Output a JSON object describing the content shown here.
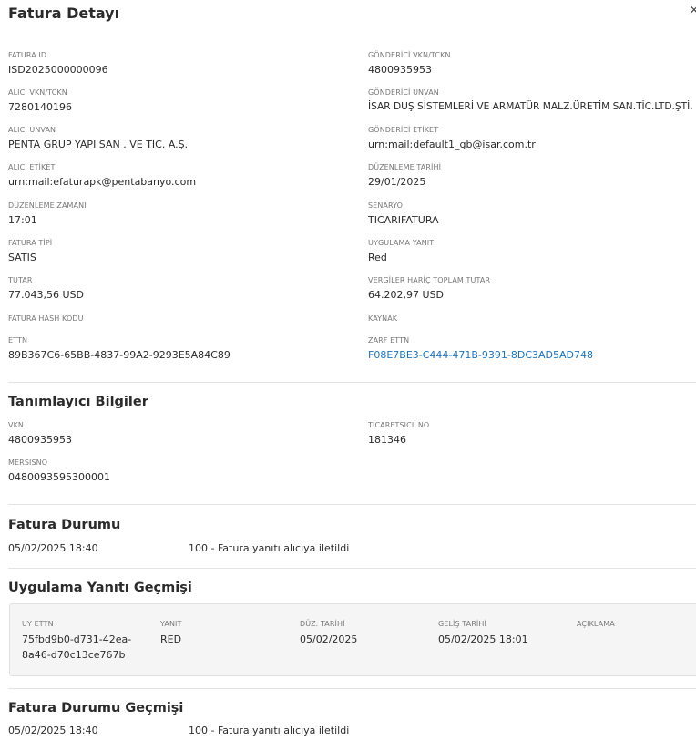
{
  "header": {
    "title": "Fatura Detayı",
    "close_label": "×"
  },
  "details": {
    "left": [
      {
        "label": "FATURA ID",
        "value": "ISD2025000000096"
      },
      {
        "label": "ALICI VKN/TCKN",
        "value": "7280140196"
      },
      {
        "label": "ALICI UNVAN",
        "value": "PENTA GRUP YAPI SAN . VE TİC. A.Ş."
      },
      {
        "label": "ALICI ETİKET",
        "value": "urn:mail:efaturapk@pentabanyo.com"
      },
      {
        "label": "DÜZENLEME ZAMANI",
        "value": "17:01"
      },
      {
        "label": "FATURA TİPİ",
        "value": "SATIS"
      },
      {
        "label": "TUTAR",
        "value": "77.043,56 USD"
      },
      {
        "label": "FATURA HASH KODU",
        "value": ""
      },
      {
        "label": "ETTN",
        "value": "89B367C6-65BB-4837-99A2-9293E5A84C89"
      }
    ],
    "right": [
      {
        "label": "GÖNDERİCİ VKN/TCKN",
        "value": "4800935953"
      },
      {
        "label": "GÖNDERİCİ UNVAN",
        "value": "İSAR DUŞ SİSTEMLERİ VE ARMATÜR MALZ.ÜRETİM SAN.TİC.LTD.ŞTİ."
      },
      {
        "label": "GÖNDERİCİ ETİKET",
        "value": "urn:mail:default1_gb@isar.com.tr"
      },
      {
        "label": "DÜZENLEME TARİHİ",
        "value": "29/01/2025"
      },
      {
        "label": "SENARYO",
        "value": "TICARIFATURA"
      },
      {
        "label": "UYGULAMA YANITI",
        "value": "Red"
      },
      {
        "label": "VERGİLER HARİÇ TOPLAM TUTAR",
        "value": "64.202,97 USD"
      },
      {
        "label": "KAYNAK",
        "value": ""
      },
      {
        "label": "ZARF ETTN",
        "value": "F08E7BE3-C444-471B-9391-8DC3AD5AD748"
      }
    ]
  },
  "identifiers": {
    "title": "Tanımlayıcı Bilgiler",
    "vkn_label": "VKN",
    "vkn_value": "4800935953",
    "ticaret_label": "TICARETSICILNO",
    "ticaret_value": "181346",
    "mersis_label": "MERSISNO",
    "mersis_value": "0480093595300001"
  },
  "status": {
    "title": "Fatura Durumu",
    "date": "05/02/2025 18:40",
    "text": "100 - Fatura yanıtı alıcıya iletildi"
  },
  "response_history": {
    "title": "Uygulama Yanıtı Geçmişi",
    "columns": [
      "UY ETTN",
      "YANIT",
      "DÜZ. TARİHİ",
      "GELİŞ TARİHİ",
      "AÇIKLAMA"
    ],
    "row": {
      "ettn_line1": "75fbd9b0-d731-42ea-",
      "ettn_line2": "8a46-d70c13ce767b",
      "yanit": "RED",
      "duz_tarihi": "05/02/2025",
      "gelis_tarihi": "05/02/2025 18:01",
      "aciklama": ""
    }
  },
  "status_history": {
    "title": "Fatura Durumu Geçmişi",
    "date": "05/02/2025 18:40",
    "text": "100 - Fatura yanıtı alıcıya iletildi"
  },
  "colors": {
    "link": "#1a73c8",
    "label": "#777777",
    "text": "#2b2b2b"
  }
}
